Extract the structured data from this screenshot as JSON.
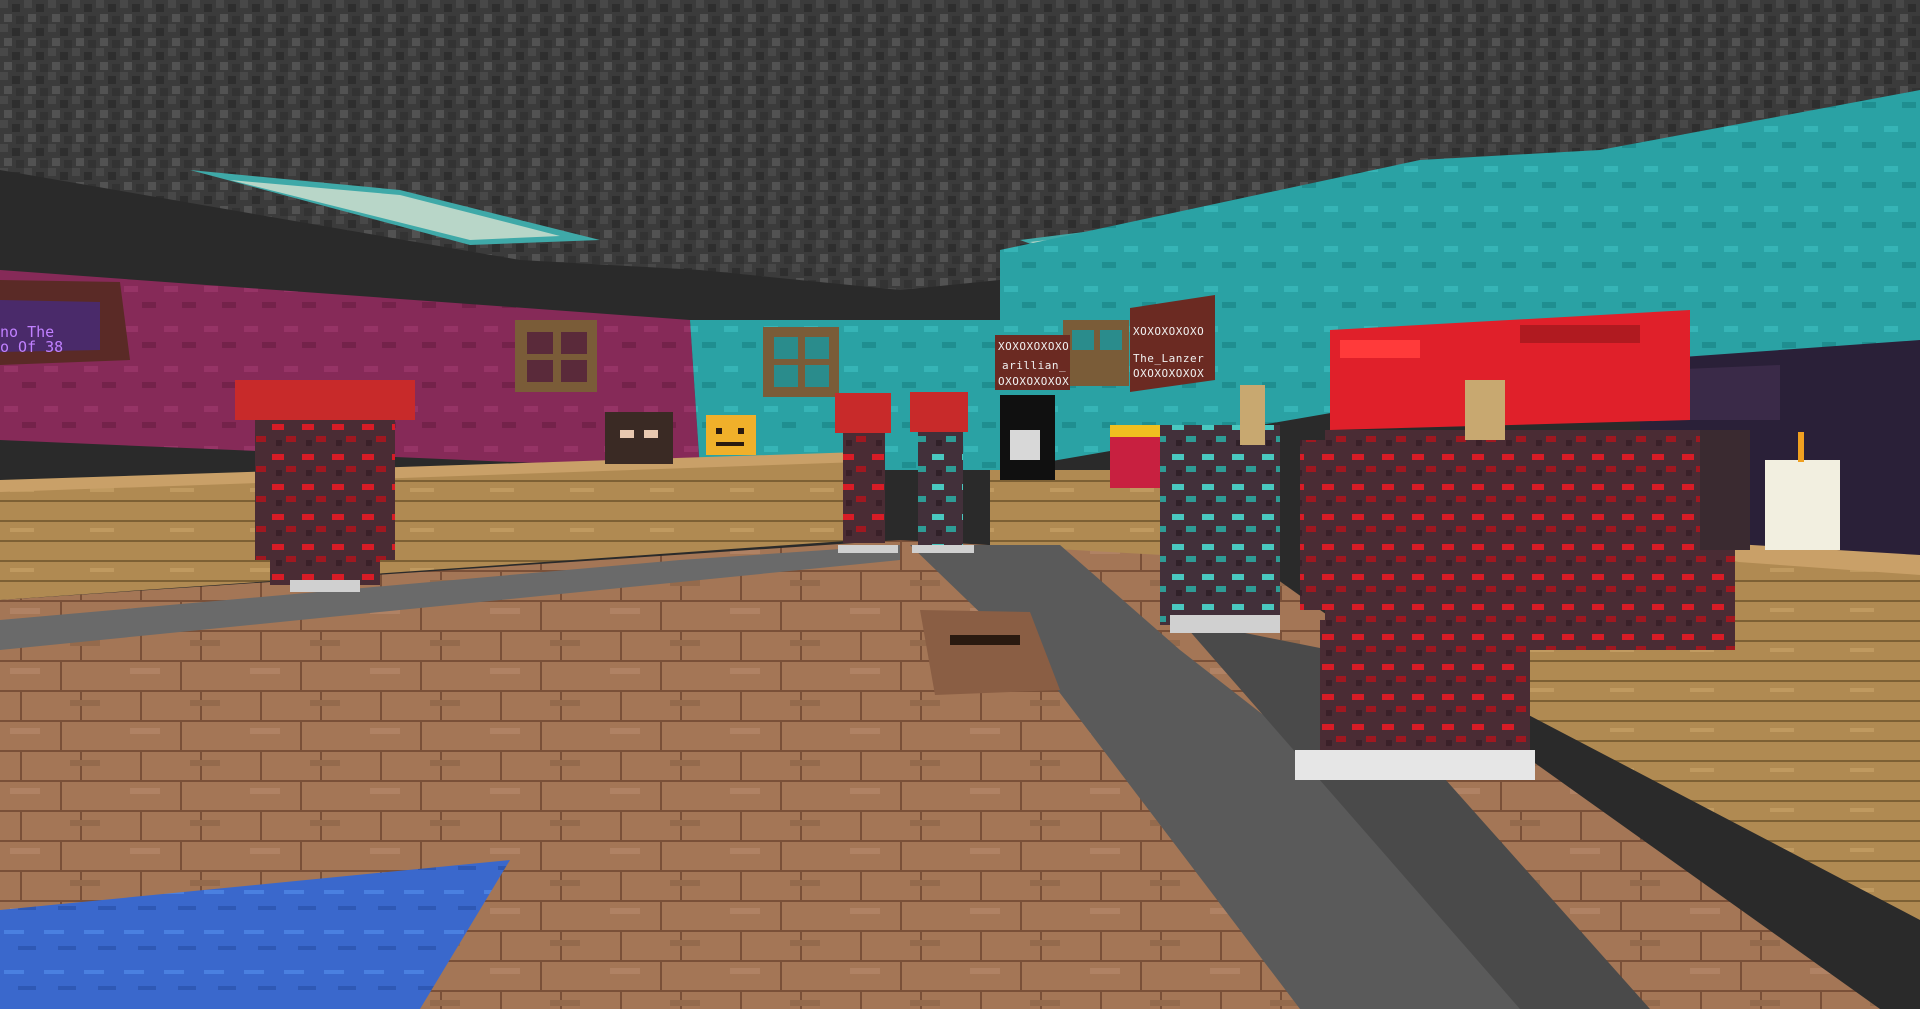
{
  "scene": {
    "type": "first-person-game-view",
    "setting": "indoor armor display room"
  },
  "signs": {
    "left_wall_line1": "no The",
    "left_wall_line2": "o Of 38",
    "center_line1": "XOXOXOXOXO",
    "center_line2": "arillian_",
    "center_line3": "OXOXOXOXOX",
    "right_line1": "XOXOXOXOXO",
    "right_line2": "The_Lanzer",
    "right_line3": "OXOXOXOXOX"
  },
  "colors": {
    "ceiling": "#3b3b3b",
    "floor_planks": "#a87a5c",
    "teal_wall": "#2aa6a6",
    "magenta_wall": "#8a2a5a",
    "sign_board": "#6b2a22",
    "netherite_red": "#e0202a",
    "netherite_dark": "#4a2a32",
    "diamond_trim": "#4ac8c0",
    "water": "#3a6cd0"
  },
  "entities": [
    {
      "name": "armor-stand-left",
      "trim": "red"
    },
    {
      "name": "armor-stand-center-left",
      "trim": "red"
    },
    {
      "name": "armor-stand-center-right",
      "trim": "diamond"
    },
    {
      "name": "armor-stand-right-near",
      "trim": "diamond"
    },
    {
      "name": "armor-stand-foreground",
      "trim": "red"
    }
  ]
}
